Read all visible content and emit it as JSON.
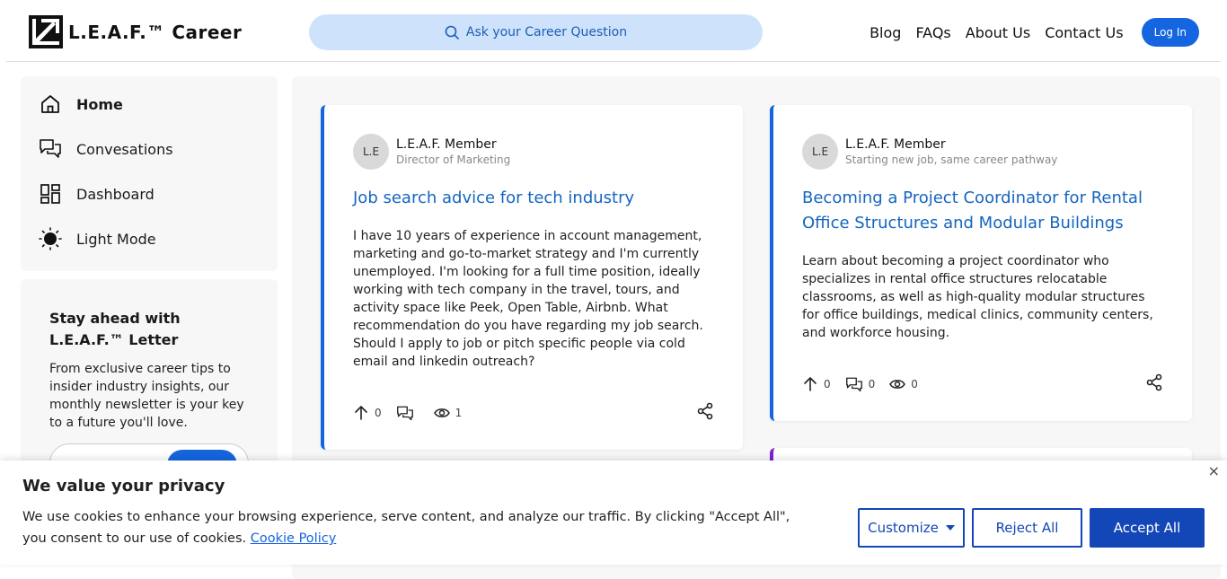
{
  "header": {
    "logo_text": "L.E.A.F.™ Career",
    "search_placeholder": "Ask your Career Question",
    "nav": [
      "Blog",
      "FAQs",
      "About Us",
      "Contact Us"
    ],
    "login_label": "Log In"
  },
  "sidebar": {
    "items": [
      {
        "label": "Home",
        "icon": "home-icon"
      },
      {
        "label": "Convesations",
        "icon": "chat-icon"
      },
      {
        "label": "Dashboard",
        "icon": "dashboard-icon"
      },
      {
        "label": "Light Mode",
        "icon": "sun-icon"
      }
    ],
    "newsletter": {
      "title": "Stay ahead with L.E.A.F.™ Letter",
      "text": "From exclusive career tips to insider industry insights, our monthly newsletter is your key to a future you'll love."
    }
  },
  "posts": [
    {
      "avatar": "L.E",
      "author": "L.E.A.F. Member",
      "role": "Director of Marketing",
      "title": "Job search advice for tech industry",
      "body": "I have 10 years of experience in account management, marketing and go-to-market strategy and I'm currently unemployed. I'm looking for a full time position, ideally working with tech company in the travel, tours, and activity space like Peek, Open Table, Airbnb. What recommendation do you have regarding my job search. Should I apply to job or pitch specific people via cold email and linkedin outreach?",
      "upvotes": "0",
      "comments": "",
      "views": "1"
    },
    {
      "avatar": "L.E",
      "author": "L.E.A.F. Member",
      "role": "Starting new job, same career pathway",
      "title": "Becoming a Project Coordinator for Rental Office Structures and Modular Buildings",
      "body": "Learn about becoming a project coordinator who specializes in rental office structures relocatable classrooms, as well as high-quality modular structures for office buildings, medical clinics, community centers, and workforce housing.",
      "upvotes": "0",
      "comments": "0",
      "views": "0"
    }
  ],
  "cookie": {
    "title": "We value your privacy",
    "text": "We use cookies to enhance your browsing experience, serve content, and analyze our traffic. By clicking \"Accept All\", you consent to our use of cookies.",
    "policy_link": "Cookie Policy",
    "customize": "Customize",
    "reject": "Reject All",
    "accept": "Accept All",
    "close": "×"
  },
  "colors": {
    "accent": "#1565e0",
    "post_border_alt": "#7e22ce"
  }
}
